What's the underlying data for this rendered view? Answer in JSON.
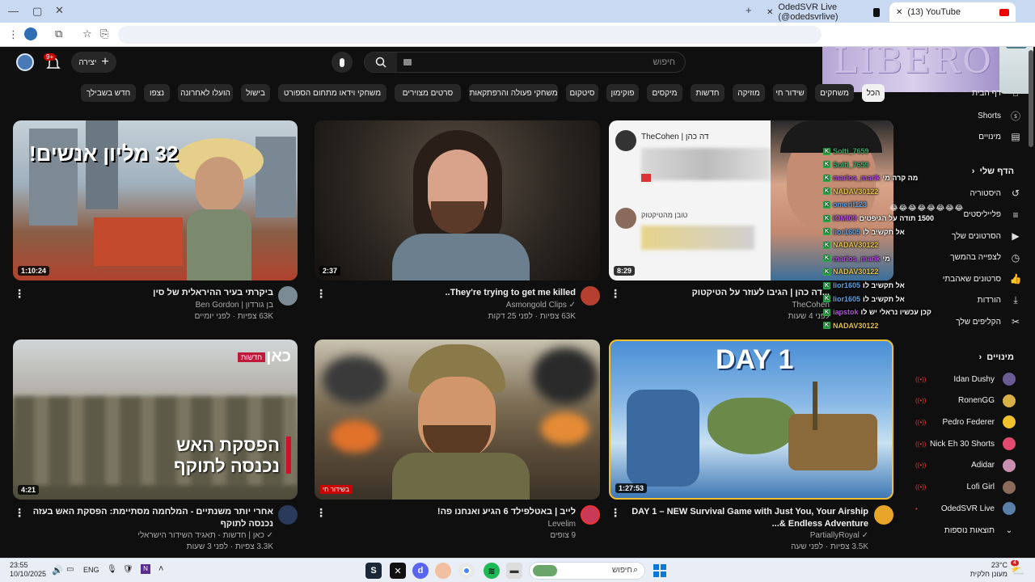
{
  "browser": {
    "tabs": [
      {
        "title": "OdedSVR Live (@odedsvrlive)"
      },
      {
        "title": "(13) YouTube"
      }
    ]
  },
  "header": {
    "create_label": "יצירה",
    "notification_count": "9+",
    "search_placeholder": "חיפוש"
  },
  "overlay_logo": "LIBERO",
  "chips": [
    "הכל",
    "משחקים",
    "שידור חי",
    "מוזיקה",
    "חדשות",
    "מיקסים",
    "פוקימון",
    "סיטקום",
    "משחקי פעולה והרפתקאות",
    "סרטים מצוירים",
    "משחקי וידאו מתחום הספורט",
    "בישול",
    "הועלו לאחרונה",
    "נצפו",
    "חדש בשבילך"
  ],
  "videos": [
    {
      "title": "ביקרתי בעיר ההיראלית של סין",
      "channel": "בן גורדון | Ben Gordon",
      "meta": "63K צפיות · לפני יומיים",
      "duration": "1:10:24",
      "thumb_text": "32 מליון אנשים!"
    },
    {
      "title": "They're trying to get me killed..",
      "channel": "Asmongold Clips",
      "meta": "63K צפיות · לפני 25 דקות",
      "duration": "2:37"
    },
    {
      "title": "...דה כהן | הגיבו לעוזר על הטיקטוק",
      "channel": "TheCohen",
      "meta": "לפני 4 שעות",
      "duration": "8:29",
      "thumb_header": "TheCohen | דה כהן",
      "thumb_sub": "טובן מהטיקטוק"
    },
    {
      "title": "אחרי יותר משנתיים - המלחמה מסתיימת: הפסקת האש בעזה נכנסה לתוקף",
      "channel": "כאן | חדשות - תאגיד השידור הישראלי",
      "meta": "3.3K צפיות · לפני 3 שעות",
      "duration": "4:21",
      "thumb_text": "הפסקת האש נכנסה לתוקף",
      "thumb_logo": "כאן",
      "thumb_badge": "חדשות"
    },
    {
      "title": "לייב | באטלפילד 6 הגיע ואנחנו פה!",
      "channel": "Levelim",
      "meta": "9 צופים",
      "live_badge": "בשידור חי"
    },
    {
      "title": "DAY 1 – NEW Survival Game with Just You, Your Airship & Endless Adventure...",
      "channel": "PartiallyRoyal",
      "meta": "3.5K צפיות · לפני שעה",
      "duration": "1:27:53",
      "thumb_text": "DAY 1"
    }
  ],
  "sidebar": {
    "top": [
      {
        "label": "דף הבית",
        "icon": "home-icon"
      },
      {
        "label": "Shorts",
        "icon": "shorts-icon"
      },
      {
        "label": "מינויים",
        "icon": "subscriptions-icon"
      }
    ],
    "you_header": "הדף שלי",
    "you": [
      {
        "label": "היסטוריה",
        "icon": "history-icon"
      },
      {
        "label": "פלייליסטים",
        "icon": "playlist-icon"
      },
      {
        "label": "הסרטונים שלך",
        "icon": "your-videos-icon"
      },
      {
        "label": "לצפייה בהמשך",
        "icon": "watch-later-icon"
      },
      {
        "label": "סרטונים שאהבתי",
        "icon": "like-icon"
      },
      {
        "label": "הורדות",
        "icon": "download-icon"
      },
      {
        "label": "הקליפים שלך",
        "icon": "clips-icon"
      }
    ],
    "subs_header": "מינויים",
    "subs": [
      {
        "name": "Idan Dushy",
        "color": "#6b5b95"
      },
      {
        "name": "RonenGG",
        "color": "#d8b048"
      },
      {
        "name": "Pedro Federer",
        "color": "#f2c12e"
      },
      {
        "name": "Nick Eh 30 Shorts",
        "color": "#e34a6f"
      },
      {
        "name": "Adidar",
        "color": "#c98fb0"
      },
      {
        "name": "Lofi Girl",
        "color": "#8a6a5a"
      },
      {
        "name": "OdedSVR Live",
        "color": "#5a7fa8"
      }
    ],
    "show_more": "תוצאות נוספות"
  },
  "chat": [
    {
      "user": "Solti_7659",
      "text": "",
      "color": "#3fa86b"
    },
    {
      "user": "Solti_7659",
      "text": "",
      "color": "#3fa86b"
    },
    {
      "user": "marios_marik",
      "text": "מה קרה מי",
      "color": "#b04fd8"
    },
    {
      "user": "NADAV30122",
      "text": "",
      "color": "#e6c34a"
    },
    {
      "user": "omeril123",
      "text": "",
      "color": "#5aa0e6"
    },
    {
      "user": "IOMI09",
      "text": "1500 תודה על הגיפטים",
      "color": "#b04fd8"
    },
    {
      "user": "lior1605",
      "text": "אל תקשיב לו",
      "color": "#5aa0e6"
    },
    {
      "user": "NADAV30122",
      "text": "",
      "color": "#e6c34a"
    },
    {
      "user": "marios_marik",
      "text": "מי",
      "color": "#b04fd8"
    },
    {
      "user": "NADAV30122",
      "text": "",
      "color": "#e6c34a"
    },
    {
      "user": "lior1605",
      "text": "אל תקשיב לו",
      "color": "#5aa0e6"
    },
    {
      "user": "lior1605",
      "text": "אל תקשיב לו",
      "color": "#5aa0e6"
    },
    {
      "user": "iapstok",
      "text": "קכן עכשיו נראלי יש לו",
      "color": "#b04fd8"
    },
    {
      "user": "NADAV30122",
      "text": "",
      "color": "#e6c34a"
    }
  ],
  "taskbar": {
    "time": "23:55",
    "date": "10/10/2025",
    "language": "ENG",
    "search_placeholder": "חיפוש",
    "weather_temp": "23°C",
    "weather_desc": "מעונן חלקית",
    "weather_badge": "4"
  }
}
